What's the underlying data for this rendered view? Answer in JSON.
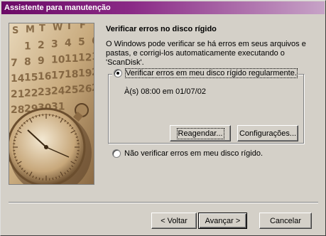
{
  "window": {
    "title": "Assistente para manutenção"
  },
  "main": {
    "heading": "Verificar erros no disco rígido",
    "description": "O Windows pode verificar se há erros em seus arquivos e pastas, e corrigi-los automaticamente executando o 'ScanDisk'.",
    "options": [
      {
        "label": "Verificar erros em meu disco rígido regularmente.",
        "selected": true
      },
      {
        "label": "Não verificar erros em meu disco rígido.",
        "selected": false
      }
    ],
    "schedule": "À(s) 08:00 em 01/07/02",
    "reschedule_label": "Reagendar...",
    "settings_label": "Configurações..."
  },
  "picture": {
    "calendar_days": [
      "S",
      "M",
      "T",
      "W",
      "T",
      "F",
      "S"
    ],
    "calendar_rows": [
      [
        "",
        "1",
        "2",
        "3",
        "4",
        "5",
        "6"
      ],
      [
        "7",
        "8",
        "9",
        "10",
        "11",
        "12",
        "13"
      ],
      [
        "14",
        "15",
        "16",
        "17",
        "18",
        "19",
        "20"
      ],
      [
        "21",
        "22",
        "23",
        "24",
        "25",
        "26",
        "27"
      ],
      [
        "28",
        "29",
        "30",
        "31",
        "",
        "",
        ""
      ]
    ]
  },
  "footer": {
    "back_label": "< Voltar",
    "next_label": "Avançar >",
    "cancel_label": "Cancelar"
  },
  "colors": {
    "title_gradient_start": "#6b0a66",
    "title_gradient_end": "#c7a3c7",
    "face": "#d4d0c8",
    "picture_tone": "#c9ab7e"
  }
}
